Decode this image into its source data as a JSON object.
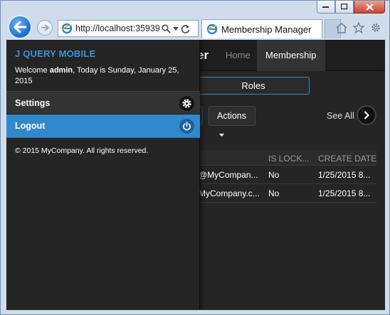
{
  "browser": {
    "url": "http://localhost:35939",
    "tab_title": "Membership Manager"
  },
  "app": {
    "brand_tail": "er",
    "nav": [
      {
        "label": "Home",
        "active": false
      },
      {
        "label": "Membership",
        "active": true
      }
    ],
    "roles_label": "Roles",
    "actions_label": "Actions",
    "see_all_label": "See All",
    "grid": {
      "columns": [
        "IS LOCK...",
        "CREATE DATE"
      ],
      "rows": [
        {
          "email": "@MyCompan...",
          "locked": "No",
          "created": "1/25/2015 8..."
        },
        {
          "email": "MyCompany.c...",
          "locked": "No",
          "created": "1/25/2015 8..."
        }
      ]
    }
  },
  "panel": {
    "title": "J QUERY MOBILE",
    "welcome_prefix": "Welcome ",
    "user": "admin",
    "welcome_suffix": ", Today is Sunday, January 25, 2015",
    "settings_label": "Settings",
    "logout_label": "Logout",
    "footer": "© 2015 MyCompany. All rights reserved."
  },
  "colors": {
    "accent": "#3388cc",
    "title_blue": "#3a92dc",
    "background": "#252525"
  }
}
